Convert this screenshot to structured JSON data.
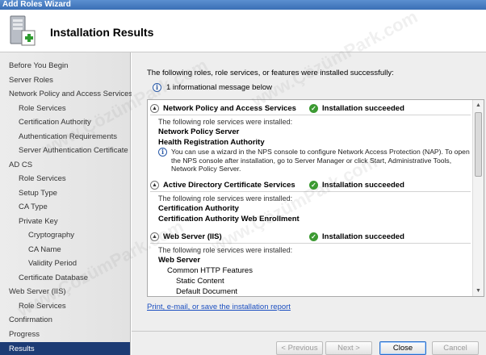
{
  "window": {
    "title": "Add Roles Wizard"
  },
  "header": {
    "title": "Installation Results"
  },
  "sidebar": {
    "items": [
      {
        "label": "Before You Begin"
      },
      {
        "label": "Server Roles"
      },
      {
        "label": "Network Policy and Access Services"
      },
      {
        "label": "Role Services"
      },
      {
        "label": "Certification Authority"
      },
      {
        "label": "Authentication Requirements"
      },
      {
        "label": "Server Authentication Certificate"
      },
      {
        "label": "AD CS"
      },
      {
        "label": "Role Services"
      },
      {
        "label": "Setup Type"
      },
      {
        "label": "CA Type"
      },
      {
        "label": "Private Key"
      },
      {
        "label": "Cryptography"
      },
      {
        "label": "CA Name"
      },
      {
        "label": "Validity Period"
      },
      {
        "label": "Certificate Database"
      },
      {
        "label": "Web Server (IIS)"
      },
      {
        "label": "Role Services"
      },
      {
        "label": "Confirmation"
      },
      {
        "label": "Progress"
      },
      {
        "label": "Results"
      }
    ]
  },
  "main": {
    "intro": "The following roles, role services, or features were installed successfully:",
    "info_count": "1 informational message below",
    "roles": [
      {
        "name": "Network Policy and Access Services",
        "status": "Installation succeeded",
        "sub_intro": "The following role services were installed:",
        "services": [
          "Network Policy Server",
          "Health Registration Authority"
        ],
        "note": "You can use a wizard in the NPS console to configure Network Access Protection (NAP). To open the NPS console after installation, go to Server Manager or click Start, Administrative Tools, Network Policy Server."
      },
      {
        "name": "Active Directory Certificate Services",
        "status": "Installation succeeded",
        "sub_intro": "The following role services were installed:",
        "services": [
          "Certification Authority",
          "Certification Authority Web Enrollment"
        ]
      },
      {
        "name": "Web Server (IIS)",
        "status": "Installation succeeded",
        "sub_intro": "The following role services were installed:",
        "services": [
          "Web Server",
          "Common HTTP Features",
          "Static Content",
          "Default Document"
        ]
      }
    ],
    "report_link": "Print, e-mail, or save the installation report"
  },
  "buttons": {
    "previous": "< Previous",
    "next": "Next >",
    "close": "Close",
    "cancel": "Cancel"
  },
  "watermark": "www.ÇözümPark.com",
  "colors": {
    "nav_active": "#1c3b74",
    "success": "#3c9a32",
    "link": "#1a4ec0"
  }
}
